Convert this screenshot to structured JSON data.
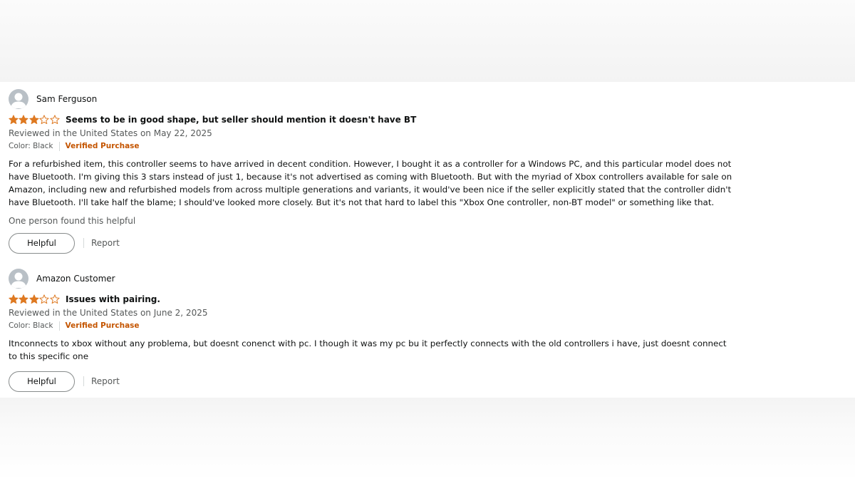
{
  "colors": {
    "star_fill": "#de7921",
    "verified": "#c45500",
    "muted_text": "#565959",
    "avatar_bg": "#b9c0c6"
  },
  "reviews": [
    {
      "profile_name": "Sam Ferguson",
      "rating": 3,
      "rating_max": 5,
      "title": "Seems to be in good shape, but seller should mention it doesn't have BT",
      "date_line": "Reviewed in the United States on May 22, 2025",
      "color": "Color: Black",
      "verified": "Verified Purchase",
      "body": "For a refurbished item, this controller seems to have arrived in decent condition. However, I bought it as a controller for a Windows PC, and this particular model does not have Bluetooth. I'm giving this 3 stars instead of just 1, because it's not advertised as coming with Bluetooth. But with the myriad of Xbox controllers available for sale on Amazon, including new and refurbished models from across multiple generations and variants, it would've been nice if the seller explicitly stated that the controller didn't have Bluetooth. I'll take half the blame; I should've looked more closely. But it's not that hard to label this \"Xbox One controller, non-BT model\" or something like that.",
      "helpful_count": "One person found this helpful",
      "helpful_label": "Helpful",
      "report_label": "Report"
    },
    {
      "profile_name": "Amazon Customer",
      "rating": 3,
      "rating_max": 5,
      "title": "Issues with pairing.",
      "date_line": "Reviewed in the United States on June 2, 2025",
      "color": "Color: Black",
      "verified": "Verified Purchase",
      "body": "Itnconnects to xbox without any problema, but doesnt conenct with pc. I though it was my pc bu it perfectly connects with the old controllers i have, just doesnt connect to this specific one",
      "helpful_label": "Helpful",
      "report_label": "Report"
    }
  ]
}
